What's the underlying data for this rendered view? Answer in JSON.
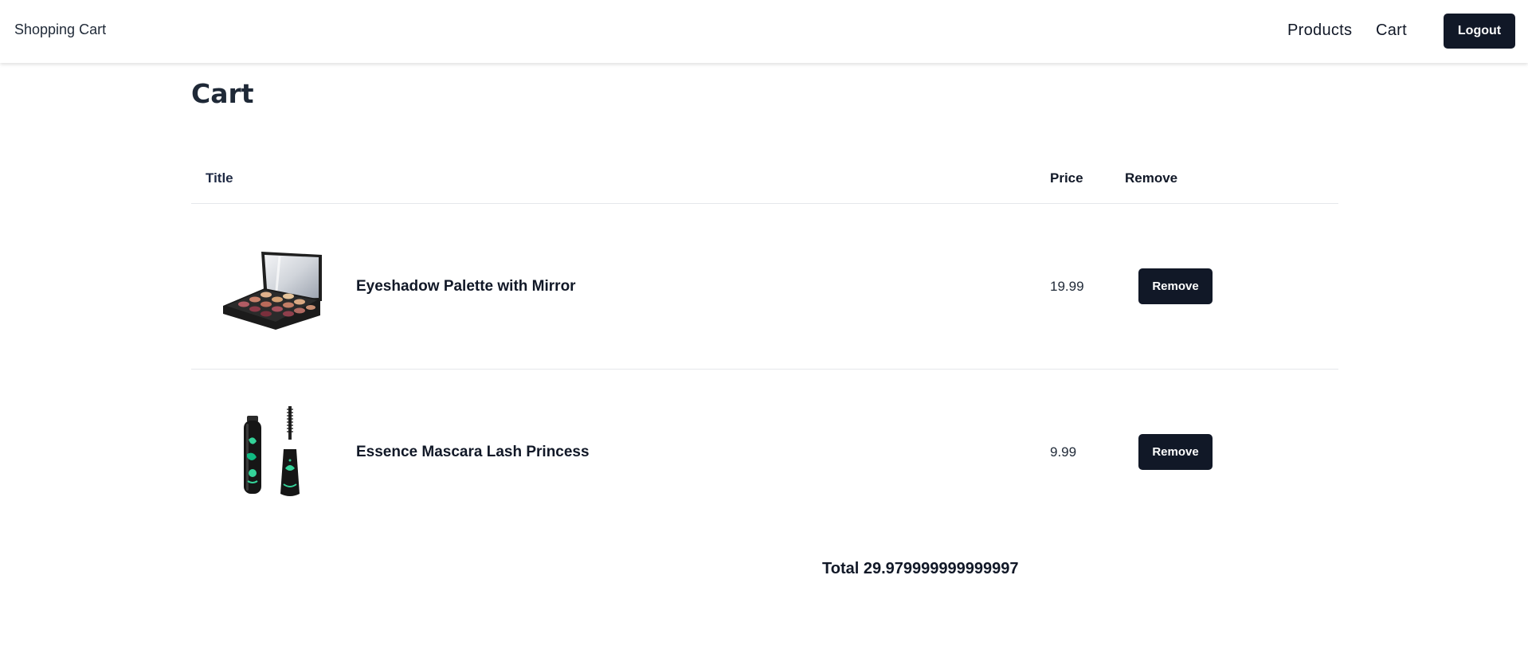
{
  "navbar": {
    "brand": "Shopping Cart",
    "links": [
      {
        "label": "Products"
      },
      {
        "label": "Cart"
      }
    ],
    "logout_label": "Logout"
  },
  "page": {
    "title": "Cart"
  },
  "table": {
    "headers": {
      "title": "Title",
      "price": "Price",
      "remove": "Remove"
    },
    "rows": [
      {
        "title": "Eyeshadow Palette with Mirror",
        "price": "19.99",
        "remove_label": "Remove",
        "thumbnail": "eyeshadow-palette-image"
      },
      {
        "title": "Essence Mascara Lash Princess",
        "price": "9.99",
        "remove_label": "Remove",
        "thumbnail": "mascara-image"
      }
    ]
  },
  "total": {
    "text": "Total 29.979999999999997"
  },
  "colors": {
    "primary_button": "#111827",
    "divider": "#e5e7eb"
  }
}
